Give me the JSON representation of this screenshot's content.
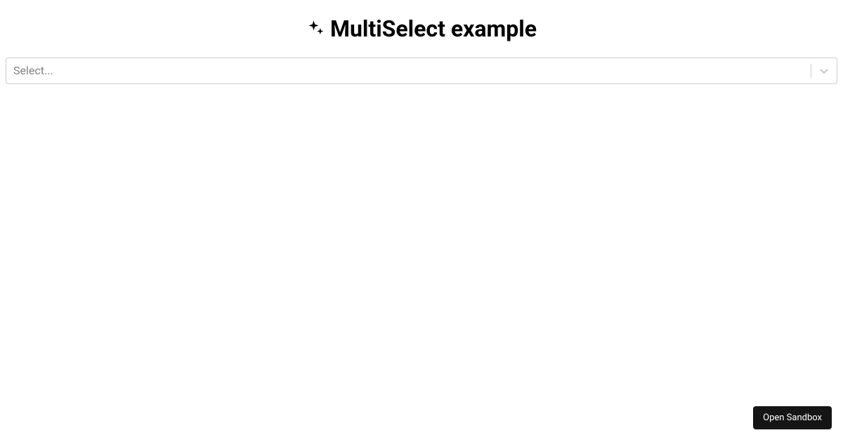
{
  "header": {
    "title": "MultiSelect example",
    "icon_name": "sparkles-icon"
  },
  "select": {
    "placeholder": "Select...",
    "value": "",
    "options": []
  },
  "footer": {
    "open_sandbox_label": "Open Sandbox"
  },
  "colors": {
    "border": "#cccccc",
    "placeholder": "#808080",
    "button_bg": "#151515",
    "button_text": "#ffffff"
  }
}
